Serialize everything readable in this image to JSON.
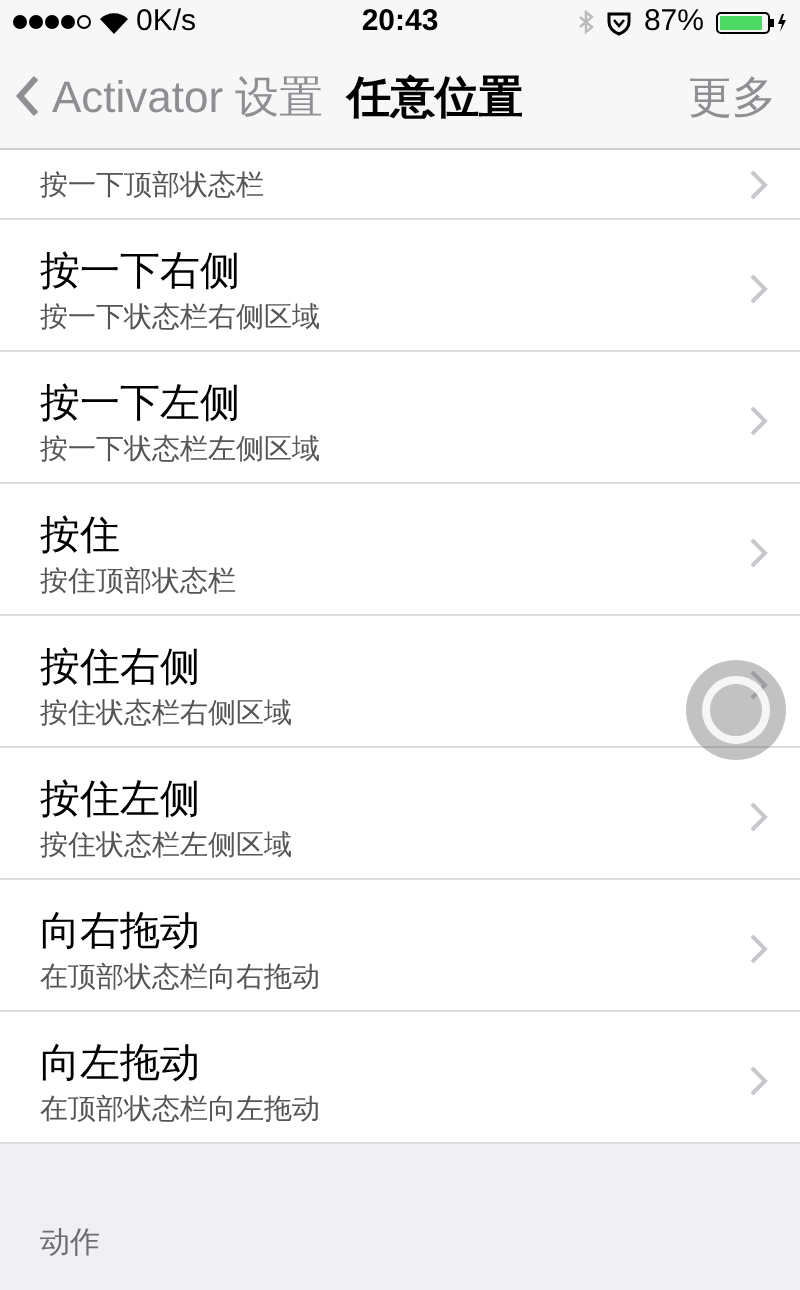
{
  "status_bar": {
    "speed": "0K/s",
    "time": "20:43",
    "battery": "87%"
  },
  "nav": {
    "back": "Activator 设置",
    "title": "任意位置",
    "action": "更多"
  },
  "rows": [
    {
      "subtitle": "按一下顶部状态栏"
    },
    {
      "title": "按一下右侧",
      "subtitle": "按一下状态栏右侧区域"
    },
    {
      "title": "按一下左侧",
      "subtitle": "按一下状态栏左侧区域"
    },
    {
      "title": "按住",
      "subtitle": "按住顶部状态栏"
    },
    {
      "title": "按住右侧",
      "subtitle": "按住状态栏右侧区域"
    },
    {
      "title": "按住左侧",
      "subtitle": "按住状态栏左侧区域"
    },
    {
      "title": "向右拖动",
      "subtitle": "在顶部状态栏向右拖动"
    },
    {
      "title": "向左拖动",
      "subtitle": "在顶部状态栏向左拖动"
    }
  ],
  "section_header": "动作"
}
